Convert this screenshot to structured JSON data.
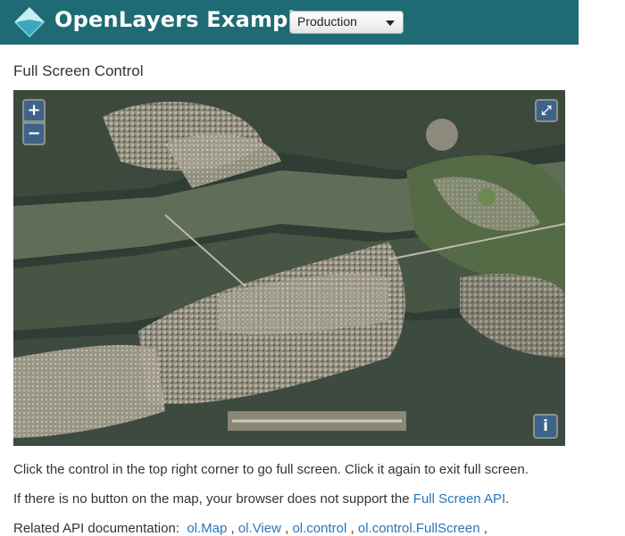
{
  "navbar": {
    "brand": "OpenLayers Examples",
    "version_select": "Production"
  },
  "page": {
    "title": "Full Screen Control"
  },
  "map": {
    "zoom_in": "+",
    "zoom_out": "−",
    "fullscreen_symbol": "⤢",
    "info_symbol": "i"
  },
  "description": {
    "line1": "Click the control in the top right corner to go full screen. Click it again to exit full screen.",
    "line2_prefix": "If there is no button on the map, your browser does not support the ",
    "line2_link": "Full Screen API",
    "line2_suffix": ".",
    "line3_prefix": "Related API documentation:",
    "api_links": [
      "ol.Map",
      "ol.View",
      "ol.control",
      "ol.control.FullScreen"
    ],
    "separator": ","
  },
  "colors": {
    "navbar": "#1f6b75",
    "link": "#2a76b8",
    "control": "rgba(0,60,136,0.55)"
  }
}
